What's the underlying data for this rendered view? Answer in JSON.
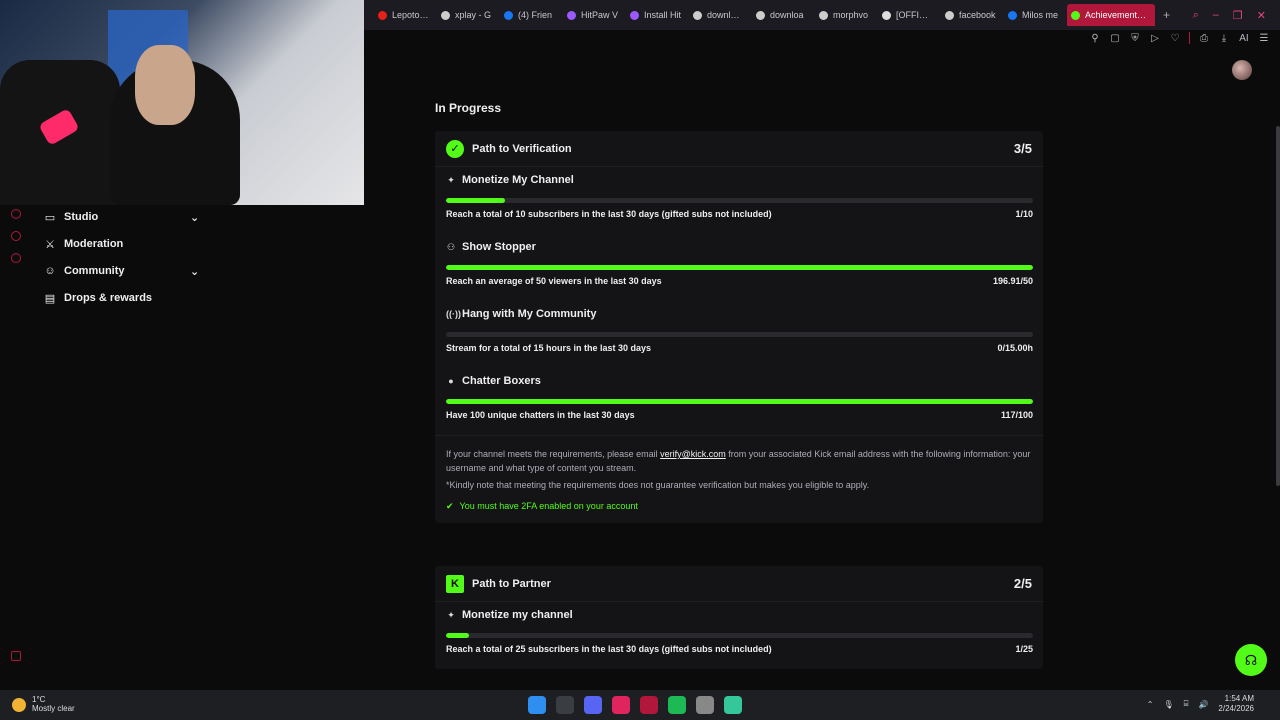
{
  "browser": {
    "tabs": [
      {
        "label": "Lepoto m",
        "color": "#e62117"
      },
      {
        "label": "xplay - G",
        "color": "#cccccc"
      },
      {
        "label": "(4) Frien",
        "color": "#1877f2"
      },
      {
        "label": "HitPaw V",
        "color": "#9b59ff"
      },
      {
        "label": "Install Hit",
        "color": "#9b59ff"
      },
      {
        "label": "download",
        "color": "#cccccc"
      },
      {
        "label": "downloa",
        "color": "#cccccc"
      },
      {
        "label": "morphvo",
        "color": "#cccccc"
      },
      {
        "label": "[OFFICIA",
        "color": "#dddddd"
      },
      {
        "label": "facebook",
        "color": "#cccccc"
      },
      {
        "label": "Milos me",
        "color": "#1877f2"
      },
      {
        "label": "Achievements - K",
        "color": "#53fc18",
        "active": true
      }
    ],
    "new_tab": "+",
    "toolbar_ai": "AI"
  },
  "sidebar": {
    "items": [
      {
        "label": "Studio",
        "icon": "studio-icon",
        "expandable": true
      },
      {
        "label": "Moderation",
        "icon": "sword-icon",
        "expandable": false
      },
      {
        "label": "Community",
        "icon": "people-icon",
        "expandable": true
      },
      {
        "label": "Drops & rewards",
        "icon": "gift-icon",
        "expandable": false
      }
    ]
  },
  "main": {
    "section_title": "In Progress",
    "verification": {
      "title": "Path to Verification",
      "count": "3/5",
      "achievements": [
        {
          "name": "Monetize My Channel",
          "icon": "sparkle-icon",
          "desc": "Reach a total of 10 subscribers in the last 30 days (gifted subs not included)",
          "value": "1/10",
          "progress": 0.1
        },
        {
          "name": "Show Stopper",
          "icon": "viewers-icon",
          "desc": "Reach an average of 50 viewers in the last 30 days",
          "value": "196.91/50",
          "progress": 1.0
        },
        {
          "name": "Hang with My Community",
          "icon": "broadcast-icon",
          "desc": "Stream for a total of 15 hours in the last 30 days",
          "value": "0/15.00h",
          "progress": 0.0
        },
        {
          "name": "Chatter Boxers",
          "icon": "chat-bubble-icon",
          "desc": "Have 100 unique chatters in the last 30 days",
          "value": "117/100",
          "progress": 1.0
        }
      ],
      "info_before": "If your channel meets the requirements, please email ",
      "info_email": "verify@kick.com",
      "info_after": " from your associated Kick email address with the following information: your username and what type of content you stream.",
      "note": "*Kindly note that meeting the requirements does not guarantee verification but makes you eligible to apply.",
      "twofa": "You must have 2FA enabled on your account"
    },
    "partner": {
      "title": "Path to Partner",
      "count": "2/5",
      "achievements": [
        {
          "name": "Monetize my channel",
          "icon": "sparkle-icon",
          "desc": "Reach a total of 25 subscribers in the last 30 days (gifted subs not included)",
          "value": "1/25",
          "progress": 0.04
        }
      ]
    }
  },
  "taskbar": {
    "temperature": "1°C",
    "weather": "Mostly clear",
    "time": "1:54 AM",
    "date": "2/24/2026"
  },
  "colors": {
    "accent": "#53fc18",
    "browser_accent": "#b1163b"
  }
}
